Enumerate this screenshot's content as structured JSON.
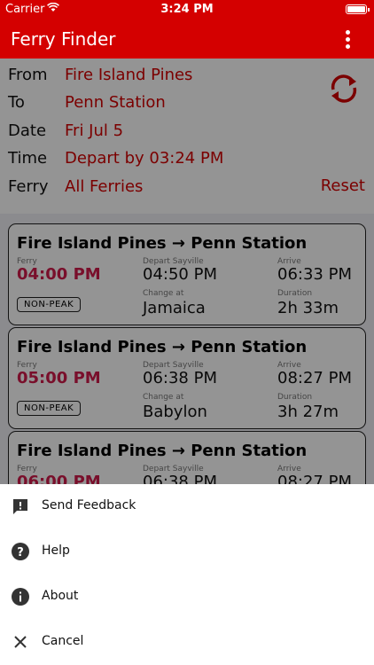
{
  "status_bar": {
    "carrier": "Carrier",
    "time": "3:24 PM"
  },
  "app_bar": {
    "title": "Ferry Finder"
  },
  "form": {
    "from": {
      "label": "From",
      "value": "Fire Island Pines"
    },
    "to": {
      "label": "To",
      "value": "Penn Station"
    },
    "date": {
      "label": "Date",
      "value": "Fri Jul 5"
    },
    "time": {
      "label": "Time",
      "value": "Depart by 03:24 PM"
    },
    "ferry": {
      "label": "Ferry",
      "value": "All Ferries"
    },
    "reset_label": "Reset"
  },
  "results": [
    {
      "route": "Fire Island Pines → Penn Station",
      "ferry_caption": "Ferry",
      "ferry_time": "04:00 PM",
      "depart_caption": "Depart Sayville",
      "depart_time": "04:50 PM",
      "arrive_caption": "Arrive",
      "arrive_time": "06:33 PM",
      "change_caption": "Change at",
      "change_station": "Jamaica",
      "duration_caption": "Duration",
      "duration": "2h 33m",
      "badge": "NON-PEAK"
    },
    {
      "route": "Fire Island Pines → Penn Station",
      "ferry_caption": "Ferry",
      "ferry_time": "05:00 PM",
      "depart_caption": "Depart Sayville",
      "depart_time": "06:38 PM",
      "arrive_caption": "Arrive",
      "arrive_time": "08:27 PM",
      "change_caption": "Change at",
      "change_station": "Babylon",
      "duration_caption": "Duration",
      "duration": "3h 27m",
      "badge": "NON-PEAK"
    },
    {
      "route": "Fire Island Pines → Penn Station",
      "ferry_caption": "Ferry",
      "ferry_time": "06:00 PM",
      "depart_caption": "Depart Sayville",
      "depart_time": "06:38 PM",
      "arrive_caption": "Arrive",
      "arrive_time": "08:27 PM"
    }
  ],
  "bottom_sheet": {
    "items": [
      {
        "label": "Send Feedback",
        "icon": "feedback-icon"
      },
      {
        "label": "Help",
        "icon": "help-icon"
      },
      {
        "label": "About",
        "icon": "info-icon"
      },
      {
        "label": "Cancel",
        "icon": "close-icon"
      }
    ]
  },
  "colors": {
    "accent": "#d40000",
    "ferry_time": "#d01a4a"
  }
}
